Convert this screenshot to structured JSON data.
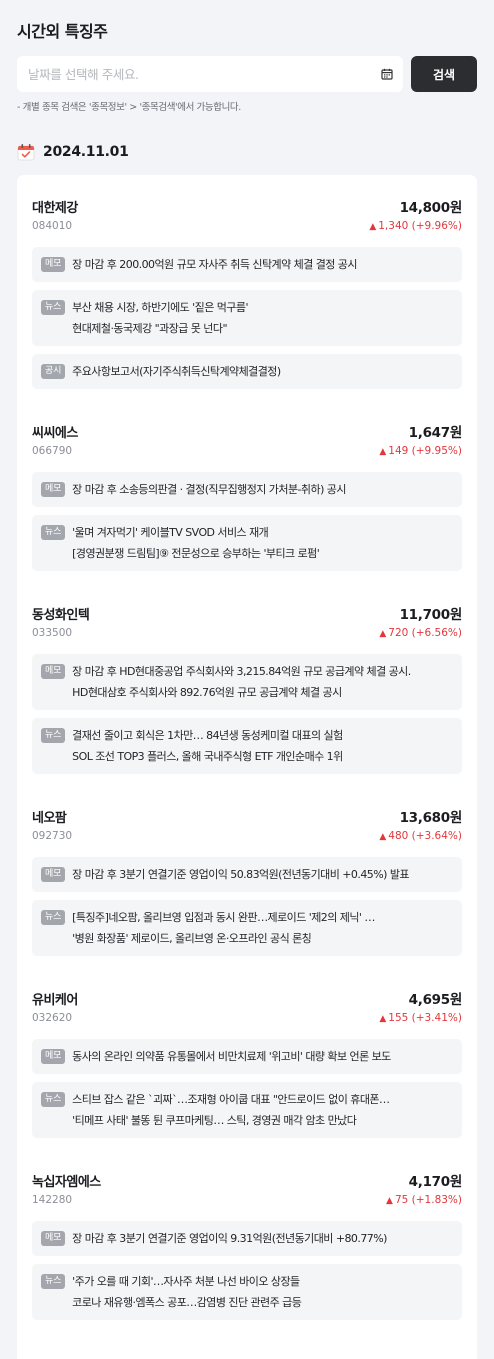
{
  "header": {
    "title": "시간외 특징주"
  },
  "search": {
    "placeholder": "날짜를 선택해 주세요.",
    "calendar_icon": "calendar-icon",
    "button_label": "검색",
    "hint": "- 개별 종목 검색은 '종목정보' > '종목검색'에서 가능합니다."
  },
  "date_section": {
    "date": "2024.11.01",
    "icon": "calendar-check-icon"
  },
  "colors": {
    "up": "#e3373c",
    "dark_button": "#2c2d31",
    "tag_bg": "#a3a6ad",
    "background": "#f3f4f7"
  },
  "stocks": [
    {
      "name": "대한제강",
      "code": "084010",
      "price": "14,800원",
      "change": "1,340 (+9.96%)",
      "items": [
        {
          "tag": "메모",
          "lines": [
            "장 마감 후 200.00억원 규모 자사주 취득 신탁계약 체결 결정 공시"
          ]
        },
        {
          "tag": "뉴스",
          "lines": [
            "부산 채용 시장, 하반기에도 '짙은 먹구름'",
            "현대제철·동국제강 \"과장급 못 넌다\""
          ]
        },
        {
          "tag": "공시",
          "lines": [
            "주요사항보고서(자기주식취득신탁계약체결결정)"
          ]
        }
      ]
    },
    {
      "name": "씨씨에스",
      "code": "066790",
      "price": "1,647원",
      "change": "149 (+9.95%)",
      "items": [
        {
          "tag": "메모",
          "lines": [
            "장 마감 후 소송등의판결 · 결정(직무집행정지 가처분-취하) 공시"
          ]
        },
        {
          "tag": "뉴스",
          "lines": [
            "'울며 겨자먹기' 케이블TV SVOD 서비스 재개",
            "[경영권분쟁 드림팀]⑨ 전문성으로 승부하는 '부티크 로펌'"
          ]
        }
      ]
    },
    {
      "name": "동성화인텍",
      "code": "033500",
      "price": "11,700원",
      "change": "720 (+6.56%)",
      "items": [
        {
          "tag": "메모",
          "lines": [
            "장 마감 후 HD현대중공업 주식회사와 3,215.84억원 규모 공급계약 체결 공시.",
            "HD현대삼호 주식회사와 892.76억원 규모 공급계약 체결 공시"
          ]
        },
        {
          "tag": "뉴스",
          "lines": [
            "결재선 줄이고 회식은 1차만… 84년생 동성케미컬 대표의 실험",
            "SOL 조선 TOP3 플러스, 올해 국내주식형 ETF 개인순매수 1위"
          ]
        }
      ]
    },
    {
      "name": "네오팜",
      "code": "092730",
      "price": "13,680원",
      "change": "480 (+3.64%)",
      "items": [
        {
          "tag": "메모",
          "lines": [
            "장 마감 후 3분기 연결기준 영업이익 50.83억원(전년동기대비 +0.45%) 발표"
          ]
        },
        {
          "tag": "뉴스",
          "lines": [
            "[특징주]네오팜, 올리브영 입점과 동시 완판…제로이드 '제2의 제닉' …",
            "'병원 화장품' 제로이드, 올리브영 온·오프라인 공식 론칭"
          ]
        }
      ]
    },
    {
      "name": "유비케어",
      "code": "032620",
      "price": "4,695원",
      "change": "155 (+3.41%)",
      "items": [
        {
          "tag": "메모",
          "lines": [
            "동사의 온라인 의약품 유통몰에서 비만치료제 '위고비' 대량 확보 언론 보도"
          ]
        },
        {
          "tag": "뉴스",
          "lines": [
            "스티브 잡스 같은 `괴짜`…조재형 아이쿱 대표 \"안드로이드 없이 휴대폰…",
            "'티메프 사태' 불똥 튄 쿠프마케팅… 스틱, 경영권 매각 암초 만났다"
          ]
        }
      ]
    },
    {
      "name": "녹십자엠에스",
      "code": "142280",
      "price": "4,170원",
      "change": "75 (+1.83%)",
      "items": [
        {
          "tag": "메모",
          "lines": [
            "장 마감 후 3분기 연결기준 영업이익 9.31억원(전년동기대비 +80.77%)"
          ]
        },
        {
          "tag": "뉴스",
          "lines": [
            "'주가 오를 때 기회'…자사주 처분 나선 바이오 상장들",
            "코로나 재유행·엠폭스 공포…감염병 진단 관련주 급등"
          ]
        }
      ]
    }
  ]
}
